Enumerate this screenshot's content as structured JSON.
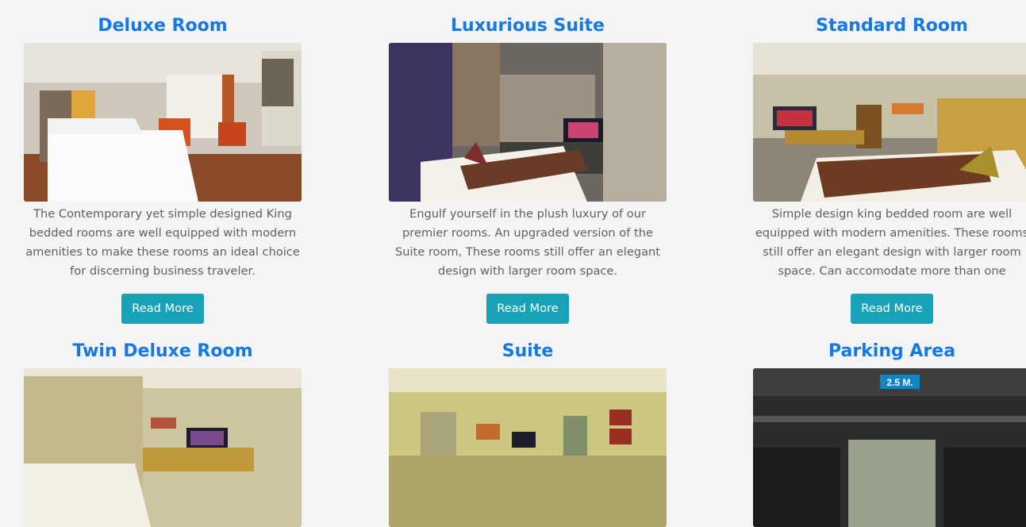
{
  "rooms": [
    {
      "title": "Deluxe Room",
      "description": "The Contemporary yet simple designed King bedded rooms are well equipped with modern amenities to make these rooms an ideal choice for discerning business traveler.",
      "button_label": "Read More"
    },
    {
      "title": "Luxurious Suite",
      "description": "Engulf yourself in the plush luxury of our premier rooms. An upgraded version of the Suite room, These rooms still offer an elegant design with larger room space.",
      "button_label": "Read More"
    },
    {
      "title": "Standard Room",
      "description": "Simple design king bedded room are well equipped with modern amenities. These rooms still offer an elegant design with larger room space. Can accomodate more than one",
      "button_label": "Read More"
    },
    {
      "title": "Twin Deluxe Room"
    },
    {
      "title": "Suite"
    },
    {
      "title": "Parking Area",
      "sign_text": "2.5 M."
    }
  ],
  "colors": {
    "heading": "#1479e6",
    "button": "#17a2b8",
    "text": "#5b6269",
    "background": "#f4f4f4"
  }
}
